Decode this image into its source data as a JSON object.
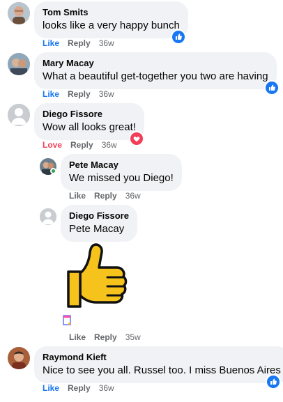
{
  "colors": {
    "bubble": "#f0f2f5",
    "meta_gray": "#65676b",
    "like_blue": "#1877f2",
    "love_red": "#f33e58",
    "online_green": "#31a24c"
  },
  "comments": [
    {
      "author": "Tom Smits",
      "text": "looks like a very happy bunch",
      "actions": {
        "reaction_label": "Like",
        "reply": "Reply",
        "time": "36w"
      },
      "reaction_icon": "like-icon"
    },
    {
      "author": "Mary Macay",
      "text": "What a beautiful get-together you two are having",
      "actions": {
        "reaction_label": "Like",
        "reply": "Reply",
        "time": "36w"
      },
      "reaction_icon": "like-icon"
    },
    {
      "author": "Diego Fissore",
      "text": "Wow all looks great!",
      "actions": {
        "reaction_label": "Love",
        "reply": "Reply",
        "time": "36w"
      },
      "reaction_icon": "love-icon"
    },
    {
      "author": "Pete Macay",
      "text": "We missed you Diego!",
      "actions": {
        "reaction_label": "Like",
        "reply": "Reply",
        "time": "36w"
      }
    },
    {
      "author": "Diego Fissore",
      "mention": "Pete Macay",
      "sticker": "thumbs-up-sticker",
      "actions": {
        "reaction_label": "Like",
        "reply": "Reply",
        "time": "35w"
      }
    },
    {
      "author": "Raymond Kieft",
      "text": "Nice to see you all. Russel too. I miss Buenos Aires",
      "actions": {
        "reaction_label": "Like",
        "reply": "Reply",
        "time": "36w"
      },
      "reaction_icon": "like-icon"
    }
  ]
}
